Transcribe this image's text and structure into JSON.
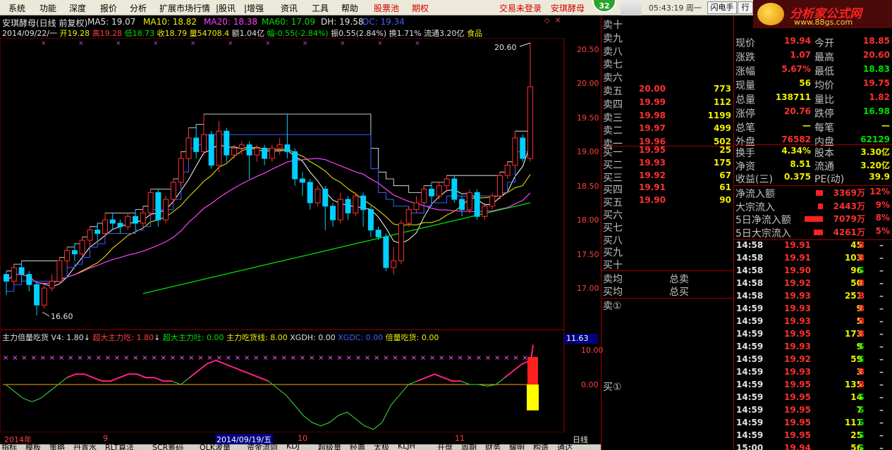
{
  "menu": {
    "items": [
      "系统",
      "功能",
      "深度",
      "报价",
      "分析",
      "扩展市场行情",
      "|股讯",
      "|增强",
      "资讯",
      "工具",
      "帮助"
    ],
    "red_items": [
      "股票池",
      "期权"
    ],
    "right_red": [
      "交易未登录",
      "安琪酵母"
    ],
    "badge": "32",
    "time": "05:43:19 周一",
    "btn1": "闪电手",
    "btn2": "行"
  },
  "logo": {
    "title": "分析家公式网",
    "url": "www.88gs.com"
  },
  "header": {
    "name": "安琪酵母(日线 前复权)",
    "ma5": "MA5: 19.07",
    "ma10": "MA10: 18.82",
    "ma20": "MA20: 18.38",
    "ma60": "MA60: 17.09",
    "dh": "DH: 19.58",
    "dc": "DC: 19.34"
  },
  "info": {
    "date": "2014/09/22/一",
    "open": "开19.28",
    "high": "高19.28",
    "low": "低18.73",
    "close": "收18.79",
    "vol": "量54708.4",
    "amt": "额1.04亿",
    "chg": "幅-0.55(-2.84%)",
    "amp": "振0.55(2.84%)",
    "turn": "换1.71%",
    "circ": "流通3.20亿",
    "sector": "食品"
  },
  "price_axis": [
    "20.50",
    "20.00",
    "19.50",
    "19.00",
    "18.50",
    "18.00",
    "17.50",
    "17.00"
  ],
  "annot": {
    "high": "20.60",
    "low": "16.60"
  },
  "indicator": {
    "title": "主力倍量吃货",
    "v4": "V4: 1.80",
    "super_eat": "超大主力吃: 1.80",
    "super_spit": "超大主力吐: 0.00",
    "main_eat": "主力吃货线: 8.00",
    "xgdh": "XGDH: 0.00",
    "xgdc": "XGDC: 0.00",
    "double": "倍量吃货: 0.00",
    "axis": [
      "11.63",
      "10.00",
      "0.00"
    ]
  },
  "time_axis": {
    "labels": [
      "2014年",
      "9",
      "2014/09/19/五",
      "10",
      "11"
    ],
    "period": "日线"
  },
  "bottom_tabs": [
    "指标",
    "模板",
    "策略",
    "丹青水",
    "RLT算法",
    "SCR筹码",
    "OLK波量",
    "资金流向",
    "KDJ",
    "超级量",
    "经典",
    "太极",
    "KLJH",
    "开盘",
    "周期",
    "财务",
    "耀明",
    "构造",
    "通达"
  ],
  "ask": [
    {
      "l": "卖十",
      "p": "",
      "v": ""
    },
    {
      "l": "卖九",
      "p": "",
      "v": ""
    },
    {
      "l": "卖八",
      "p": "",
      "v": ""
    },
    {
      "l": "卖七",
      "p": "",
      "v": ""
    },
    {
      "l": "卖六",
      "p": "",
      "v": ""
    },
    {
      "l": "卖五",
      "p": "20.00",
      "v": "773"
    },
    {
      "l": "卖四",
      "p": "19.99",
      "v": "112"
    },
    {
      "l": "卖三",
      "p": "19.98",
      "v": "1199"
    },
    {
      "l": "卖二",
      "p": "19.97",
      "v": "499"
    },
    {
      "l": "卖一",
      "p": "19.96",
      "v": "502"
    }
  ],
  "bid": [
    {
      "l": "买一",
      "p": "19.95",
      "v": "25"
    },
    {
      "l": "买二",
      "p": "19.93",
      "v": "175"
    },
    {
      "l": "买三",
      "p": "19.92",
      "v": "67"
    },
    {
      "l": "买四",
      "p": "19.91",
      "v": "61"
    },
    {
      "l": "买五",
      "p": "19.90",
      "v": "90"
    },
    {
      "l": "买六",
      "p": "",
      "v": ""
    },
    {
      "l": "买七",
      "p": "",
      "v": ""
    },
    {
      "l": "买八",
      "p": "",
      "v": ""
    },
    {
      "l": "买九",
      "p": "",
      "v": ""
    },
    {
      "l": "买十",
      "p": "",
      "v": ""
    }
  ],
  "avg": {
    "sell_avg": "卖均",
    "sell_total": "总卖",
    "buy_avg": "买均",
    "buy_total": "总买",
    "sell_first": "卖①",
    "buy_first": "买①"
  },
  "quote": [
    {
      "a": "现价",
      "av": "19.94",
      "b": "今开",
      "bv": "18.85",
      "ac": "#ff3030",
      "bc": "#ff3030"
    },
    {
      "a": "涨跌",
      "av": "1.07",
      "b": "最高",
      "bv": "20.60",
      "ac": "#ff3030",
      "bc": "#ff3030"
    },
    {
      "a": "涨幅",
      "av": "5.67%",
      "b": "最低",
      "bv": "18.83",
      "ac": "#ff3030",
      "bc": "#00e000"
    },
    {
      "a": "现量",
      "av": "56",
      "b": "均价",
      "bv": "19.75",
      "ac": "#f0f000",
      "bc": "#ff3030"
    },
    {
      "a": "总量",
      "av": "138711",
      "b": "量比",
      "bv": "1.82",
      "ac": "#f0f000",
      "bc": "#ff3030"
    },
    {
      "a": "涨停",
      "av": "20.76",
      "b": "跌停",
      "bv": "16.98",
      "ac": "#ff3030",
      "bc": "#00e000"
    },
    {
      "a": "总笔",
      "av": "—",
      "b": "每笔",
      "bv": "—",
      "ac": "#f0f000",
      "bc": "#f0f000"
    },
    {
      "a": "外盘",
      "av": "76582",
      "b": "内盘",
      "bv": "62129",
      "ac": "#ff3030",
      "bc": "#00e000"
    }
  ],
  "quote2": [
    {
      "a": "换手",
      "av": "4.34%",
      "b": "股本",
      "bv": "3.30亿",
      "ac": "#f0f000",
      "bc": "#f0f000"
    },
    {
      "a": "净资",
      "av": "8.51",
      "b": "流通",
      "bv": "3.20亿",
      "ac": "#f0f000",
      "bc": "#f0f000"
    },
    {
      "a": "收益(三)",
      "av": "0.375",
      "b": "PE(动)",
      "bv": "39.9",
      "ac": "#f0f000",
      "bc": "#f0f000"
    }
  ],
  "flows": [
    {
      "l": "净流入额",
      "v": "3369万",
      "p": "12%",
      "bar": 0.3
    },
    {
      "l": "大宗流入",
      "v": "2443万",
      "p": "9%",
      "bar": 0.22
    },
    {
      "l": "5日净流入额",
      "v": "7079万",
      "p": "8%",
      "bar": 0.8
    },
    {
      "l": "5日大宗流入",
      "v": "4261万",
      "p": "5%",
      "bar": 0.4
    }
  ],
  "ticks": [
    {
      "t": "14:58",
      "p": "19.91",
      "v": "45",
      "s": "B"
    },
    {
      "t": "14:58",
      "p": "19.91",
      "v": "103",
      "s": "B"
    },
    {
      "t": "14:58",
      "p": "19.90",
      "v": "96",
      "s": "S"
    },
    {
      "t": "14:58",
      "p": "19.92",
      "v": "50",
      "s": "B"
    },
    {
      "t": "14:58",
      "p": "19.93",
      "v": "251",
      "s": "B"
    },
    {
      "t": "14:59",
      "p": "19.93",
      "v": "9",
      "s": "B"
    },
    {
      "t": "14:59",
      "p": "19.93",
      "v": "5",
      "s": "B"
    },
    {
      "t": "14:59",
      "p": "19.95",
      "v": "173",
      "s": "B"
    },
    {
      "t": "14:59",
      "p": "19.93",
      "v": "9",
      "s": "S"
    },
    {
      "t": "14:59",
      "p": "19.92",
      "v": "59",
      "s": "S"
    },
    {
      "t": "14:59",
      "p": "19.93",
      "v": "3",
      "s": "B"
    },
    {
      "t": "14:59",
      "p": "19.95",
      "v": "135",
      "s": "B"
    },
    {
      "t": "14:59",
      "p": "19.95",
      "v": "14",
      "s": "S"
    },
    {
      "t": "14:59",
      "p": "19.95",
      "v": "7",
      "s": "S"
    },
    {
      "t": "14:59",
      "p": "19.95",
      "v": "111",
      "s": "S"
    },
    {
      "t": "14:59",
      "p": "19.95",
      "v": "25",
      "s": "S"
    },
    {
      "t": "15:00",
      "p": "19.94",
      "v": "56",
      "s": "S"
    }
  ],
  "colors": {
    "up": "#ff3030",
    "down": "#00d0ff",
    "ma5": "#ffffff",
    "ma10": "#f0f000",
    "ma20": "#ff40ff",
    "ma60": "#00e000",
    "dh": "#4060ff"
  },
  "candles": [
    [
      17.2,
      17.1,
      16.9,
      17.25
    ],
    [
      17.1,
      17.3,
      17.05,
      17.35
    ],
    [
      17.3,
      17.2,
      17.1,
      17.4
    ],
    [
      17.2,
      17.05,
      16.95,
      17.25
    ],
    [
      17.05,
      16.75,
      16.6,
      17.1
    ],
    [
      16.75,
      17.0,
      16.7,
      17.05
    ],
    [
      17.0,
      17.1,
      16.95,
      17.2
    ],
    [
      17.1,
      17.4,
      17.05,
      17.45
    ],
    [
      17.4,
      17.55,
      17.3,
      17.6
    ],
    [
      17.55,
      17.5,
      17.4,
      17.65
    ],
    [
      17.5,
      17.7,
      17.45,
      17.75
    ],
    [
      17.7,
      17.85,
      17.6,
      17.9
    ],
    [
      17.85,
      17.8,
      17.7,
      17.95
    ],
    [
      17.8,
      18.0,
      17.75,
      18.1
    ],
    [
      18.0,
      17.95,
      17.85,
      18.1
    ],
    [
      17.95,
      17.9,
      17.8,
      18.0
    ],
    [
      17.9,
      18.05,
      17.85,
      18.1
    ],
    [
      18.05,
      17.95,
      17.85,
      18.15
    ],
    [
      17.95,
      18.1,
      17.9,
      18.2
    ],
    [
      18.1,
      18.4,
      18.05,
      18.45
    ],
    [
      18.4,
      18.0,
      17.9,
      18.45
    ],
    [
      18.0,
      18.3,
      17.95,
      18.35
    ],
    [
      18.3,
      18.55,
      18.25,
      18.6
    ],
    [
      18.55,
      18.9,
      18.5,
      19.0
    ],
    [
      18.9,
      19.2,
      18.85,
      19.35
    ],
    [
      19.2,
      19.0,
      18.9,
      19.4
    ],
    [
      19.0,
      19.25,
      18.95,
      19.55
    ],
    [
      19.25,
      18.8,
      18.75,
      19.3
    ],
    [
      18.8,
      19.3,
      18.7,
      19.45
    ],
    [
      19.3,
      18.95,
      18.85,
      19.35
    ],
    [
      18.95,
      19.05,
      18.9,
      19.1
    ],
    [
      19.05,
      19.1,
      18.95,
      19.15
    ],
    [
      19.1,
      18.95,
      18.6,
      19.15
    ],
    [
      18.95,
      19.05,
      18.85,
      19.1
    ],
    [
      19.05,
      18.9,
      18.8,
      19.1
    ],
    [
      18.9,
      19.05,
      18.85,
      19.1
    ],
    [
      19.05,
      19.1,
      18.95,
      19.2
    ],
    [
      19.1,
      19.0,
      18.9,
      19.55
    ],
    [
      19.0,
      18.6,
      18.5,
      19.05
    ],
    [
      18.6,
      18.55,
      18.35,
      18.7
    ],
    [
      18.55,
      18.25,
      18.15,
      18.6
    ],
    [
      18.25,
      18.45,
      18.2,
      18.5
    ],
    [
      18.45,
      18.2,
      17.85,
      18.5
    ],
    [
      18.2,
      18.0,
      17.9,
      18.25
    ],
    [
      18.0,
      18.3,
      17.95,
      18.4
    ],
    [
      18.3,
      18.1,
      18.0,
      18.35
    ],
    [
      18.1,
      18.35,
      18.05,
      18.4
    ],
    [
      18.35,
      18.15,
      17.9,
      18.4
    ],
    [
      18.15,
      17.85,
      17.75,
      18.2
    ],
    [
      17.85,
      17.75,
      17.7,
      17.9
    ],
    [
      17.75,
      17.3,
      17.25,
      17.8
    ],
    [
      17.3,
      17.4,
      17.2,
      17.6
    ],
    [
      17.4,
      17.95,
      17.35,
      18.0
    ],
    [
      17.95,
      18.15,
      17.9,
      18.2
    ],
    [
      18.15,
      18.25,
      18.1,
      18.35
    ],
    [
      18.25,
      18.45,
      18.2,
      18.5
    ],
    [
      18.45,
      18.35,
      18.25,
      18.55
    ],
    [
      18.35,
      18.5,
      18.3,
      18.55
    ],
    [
      18.5,
      18.6,
      18.4,
      18.65
    ],
    [
      18.6,
      18.3,
      18.25,
      18.65
    ],
    [
      18.3,
      18.15,
      18.05,
      18.35
    ],
    [
      18.15,
      18.4,
      18.1,
      18.45
    ],
    [
      18.4,
      18.05,
      18.0,
      18.45
    ],
    [
      18.05,
      18.2,
      18.0,
      18.25
    ],
    [
      18.2,
      18.35,
      18.15,
      18.4
    ],
    [
      18.35,
      18.65,
      18.3,
      18.7
    ],
    [
      18.65,
      18.8,
      18.6,
      18.85
    ],
    [
      18.8,
      19.2,
      18.75,
      19.3
    ],
    [
      19.2,
      18.9,
      18.85,
      19.25
    ],
    [
      18.9,
      19.95,
      18.85,
      20.6
    ]
  ]
}
